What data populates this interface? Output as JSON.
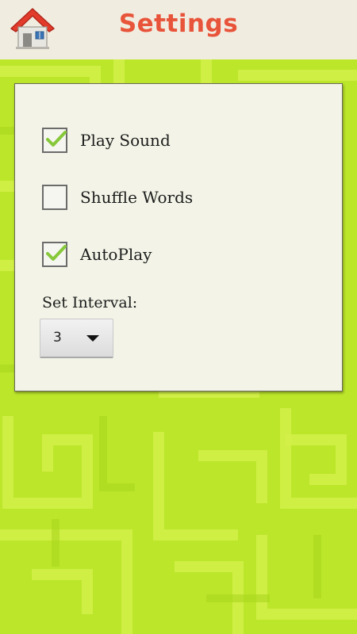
{
  "header": {
    "title": "Settings",
    "home_icon": "home-icon",
    "title_color": "#e8543a"
  },
  "settings": {
    "options": [
      {
        "label": "Play Sound",
        "checked": true
      },
      {
        "label": "Shuffle Words",
        "checked": false
      },
      {
        "label": "AutoPlay",
        "checked": true
      }
    ],
    "interval_label": "Set Interval:",
    "interval_value": "3"
  },
  "colors": {
    "background": "#bce62a",
    "check": "#86c83a",
    "header_bg": "#f1ece0",
    "panel_bg": "#f3f4e7"
  }
}
